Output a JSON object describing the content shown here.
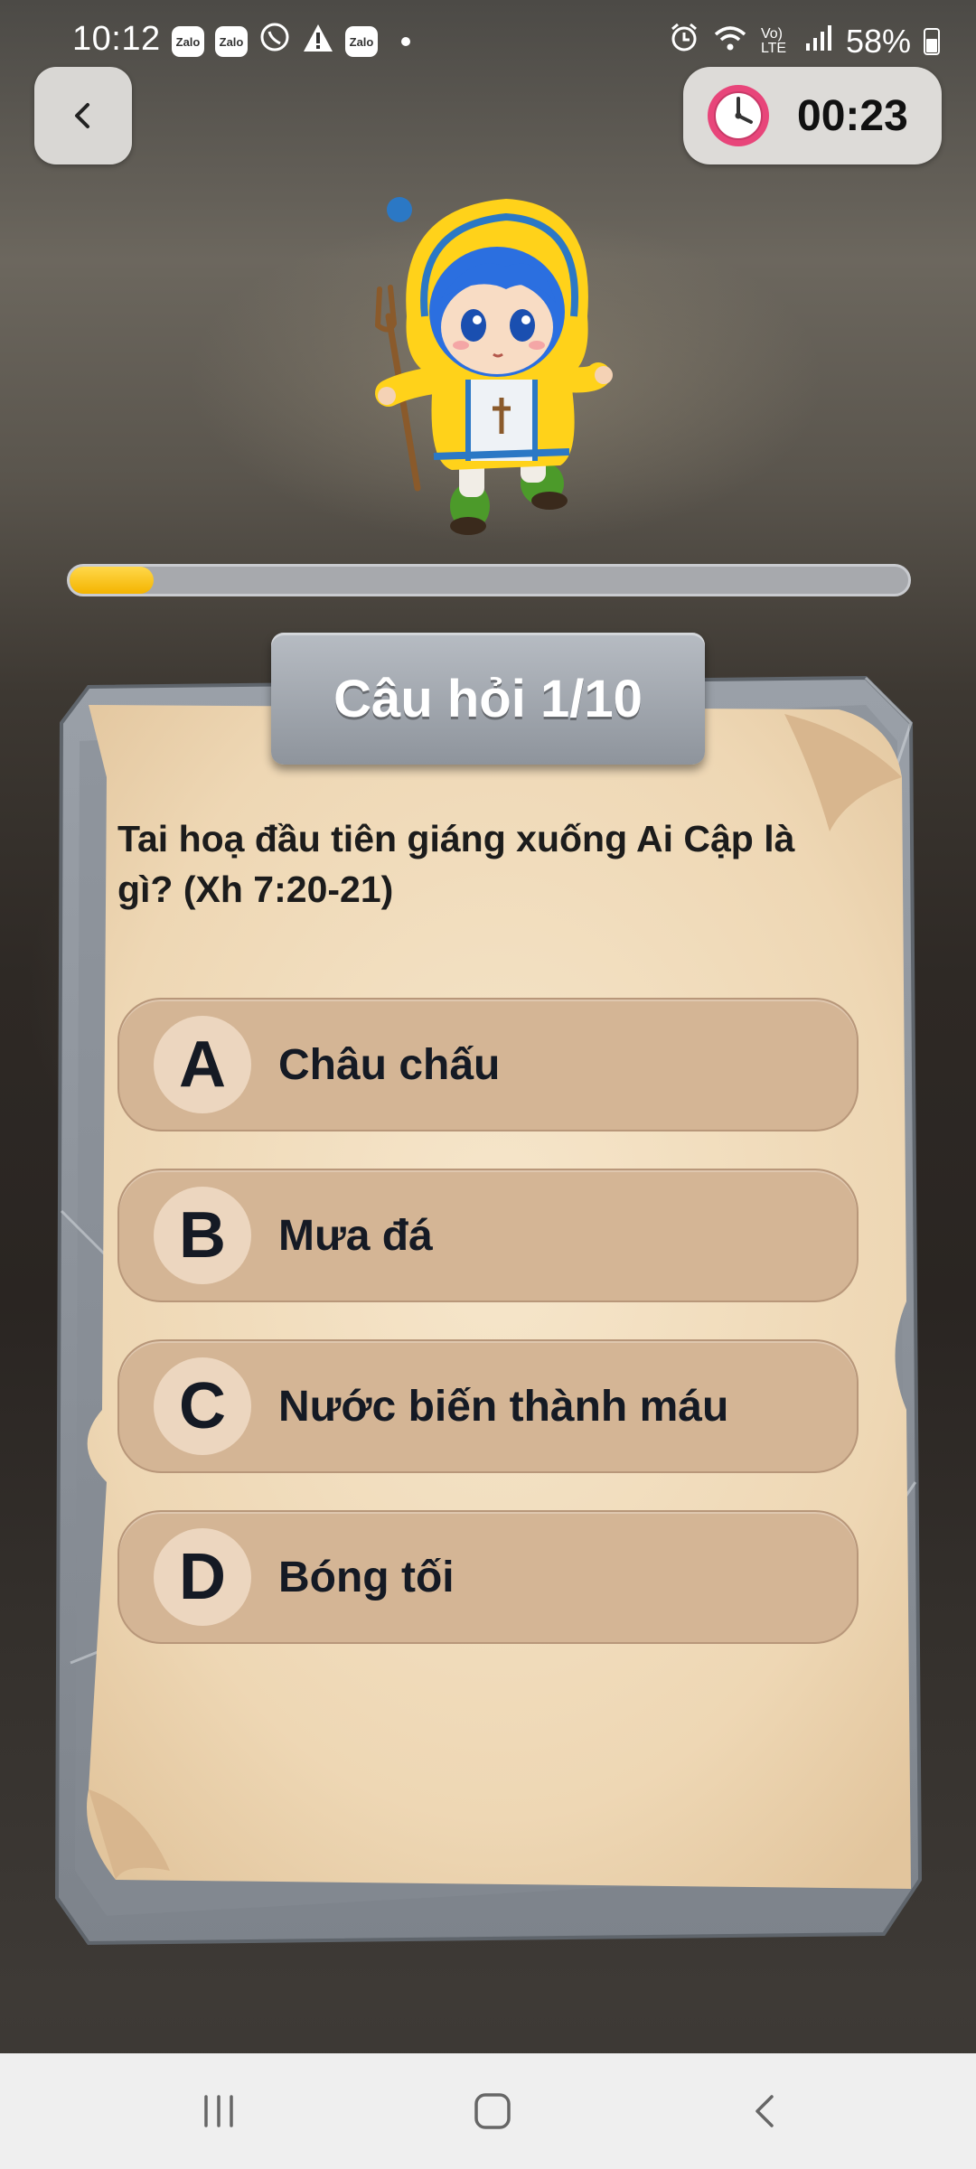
{
  "status_bar": {
    "time": "10:12",
    "left_icons": [
      "zalo-icon",
      "zalo-icon",
      "viber-icon",
      "warning-icon",
      "zalo-icon"
    ],
    "zalo_label": "Zalo",
    "right_icons": [
      "alarm-icon",
      "wifi-icon",
      "volte-icon",
      "signal-icon",
      "battery-icon"
    ],
    "volte_label": "Vo) LTE",
    "battery": "58%"
  },
  "timer": {
    "value": "00:23"
  },
  "progress": {
    "fraction": 0.1
  },
  "quiz": {
    "title": "Câu hỏi 1/10",
    "question": "Tai hoạ đầu tiên giáng xuống Ai Cập là gì? (Xh 7:20-21)",
    "answers": [
      {
        "letter": "A",
        "text": "Châu chấu"
      },
      {
        "letter": "B",
        "text": "Mưa đá"
      },
      {
        "letter": "C",
        "text": "Nước biến thành máu"
      },
      {
        "letter": "D",
        "text": "Bóng tối"
      }
    ]
  },
  "colors": {
    "accent": "#f4b400",
    "answer_bg": "#d4b595",
    "paper": "#efd9b8"
  },
  "nav": [
    "recent-apps-icon",
    "home-icon",
    "back-icon"
  ]
}
